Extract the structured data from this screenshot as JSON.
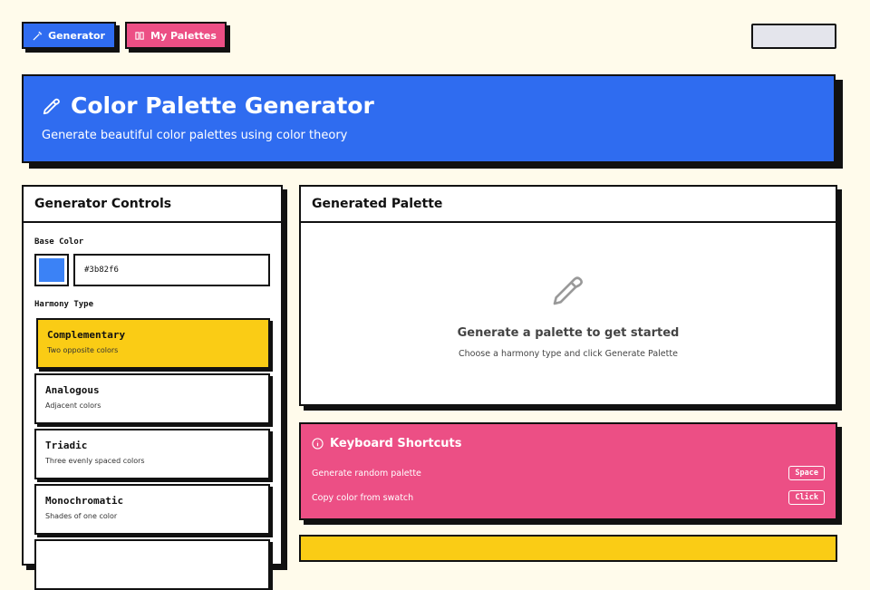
{
  "nav": {
    "generator_label": "Generator",
    "palettes_label": "My Palettes"
  },
  "hero": {
    "title": "Color Palette Generator",
    "subtitle": "Generate beautiful color palettes using color theory"
  },
  "controls": {
    "title": "Generator Controls",
    "base_color_label": "Base Color",
    "base_color_value": "#3b82f6",
    "harmony_label": "Harmony Type",
    "harmonies": [
      {
        "title": "Complementary",
        "desc": "Two opposite colors",
        "selected": true
      },
      {
        "title": "Analogous",
        "desc": "Adjacent colors",
        "selected": false
      },
      {
        "title": "Triadic",
        "desc": "Three evenly spaced colors",
        "selected": false
      },
      {
        "title": "Monochromatic",
        "desc": "Shades of one color",
        "selected": false
      }
    ]
  },
  "palette": {
    "title": "Generated Palette",
    "empty_title": "Generate a palette to get started",
    "empty_sub": "Choose a harmony type and click Generate Palette"
  },
  "shortcuts": {
    "title": "Keyboard Shortcuts",
    "rows": [
      {
        "action": "Generate random palette",
        "key": "Space"
      },
      {
        "action": "Copy color from swatch",
        "key": "Click"
      }
    ]
  },
  "colors": {
    "blue": "#2f6cf0",
    "pink": "#ec4f85",
    "yellow": "#facc15",
    "cream": "#fffbeb"
  }
}
